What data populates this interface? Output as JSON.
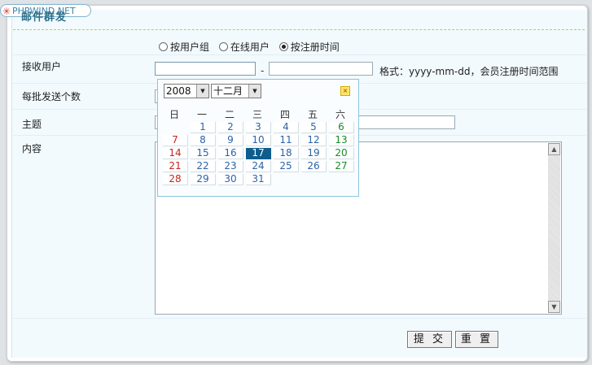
{
  "header": {
    "watermark": "PHPWIND.NET",
    "section_title": "邮件群发"
  },
  "recipient_mode": {
    "options": [
      {
        "label": "按用户组",
        "checked": false
      },
      {
        "label": "在线用户",
        "checked": false
      },
      {
        "label": "按注册时间",
        "checked": true
      }
    ]
  },
  "form": {
    "recipients_label": "接收用户",
    "range_separator": "-",
    "date_hint": "格式：yyyy-mm-dd，会员注册时间范围",
    "batch_label": "每批发送个数",
    "subject_label": "主题",
    "content_label": "内容",
    "submit_label": "提 交",
    "reset_label": "重 置"
  },
  "calendar": {
    "year": "2008",
    "month": "十二月",
    "weekdays": [
      "日",
      "一",
      "二",
      "三",
      "四",
      "五",
      "六"
    ],
    "first_weekday": 1,
    "days_in_month": 31,
    "selected_day": 17,
    "close_icon": "close-icon",
    "colors": {
      "sunday": "#c8231e",
      "saturday": "#1a8a2a",
      "weekday": "#2b63a8",
      "selected_bg": "#0f5d8c"
    }
  }
}
